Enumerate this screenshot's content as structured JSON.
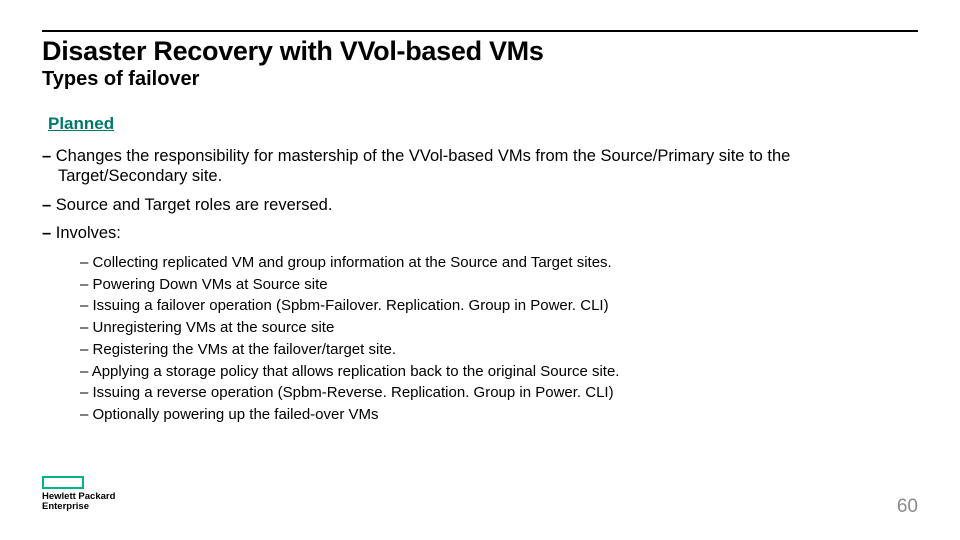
{
  "title": "Disaster Recovery with VVol-based VMs",
  "subtitle": "Types of failover",
  "section_heading": "Planned",
  "bullets": [
    "Changes the responsibility for mastership of the VVol-based VMs from the Source/Primary site to the Target/Secondary site.",
    "Source and Target roles are reversed.",
    "Involves:"
  ],
  "sub_bullets": [
    "Collecting replicated VM and group information at the Source and Target sites.",
    "Powering Down VMs at Source site",
    "Issuing a failover operation (Spbm-Failover. Replication. Group in Power. CLI)",
    "Unregistering VMs at the source site",
    "Registering the VMs at the failover/target site.",
    "Applying a storage policy that allows replication back to the original Source site.",
    "Issuing a reverse operation (Spbm-Reverse. Replication. Group in Power. CLI)",
    "Optionally powering up the failed-over VMs"
  ],
  "logo": {
    "line1": "Hewlett Packard",
    "line2": "Enterprise"
  },
  "page_number": "60"
}
